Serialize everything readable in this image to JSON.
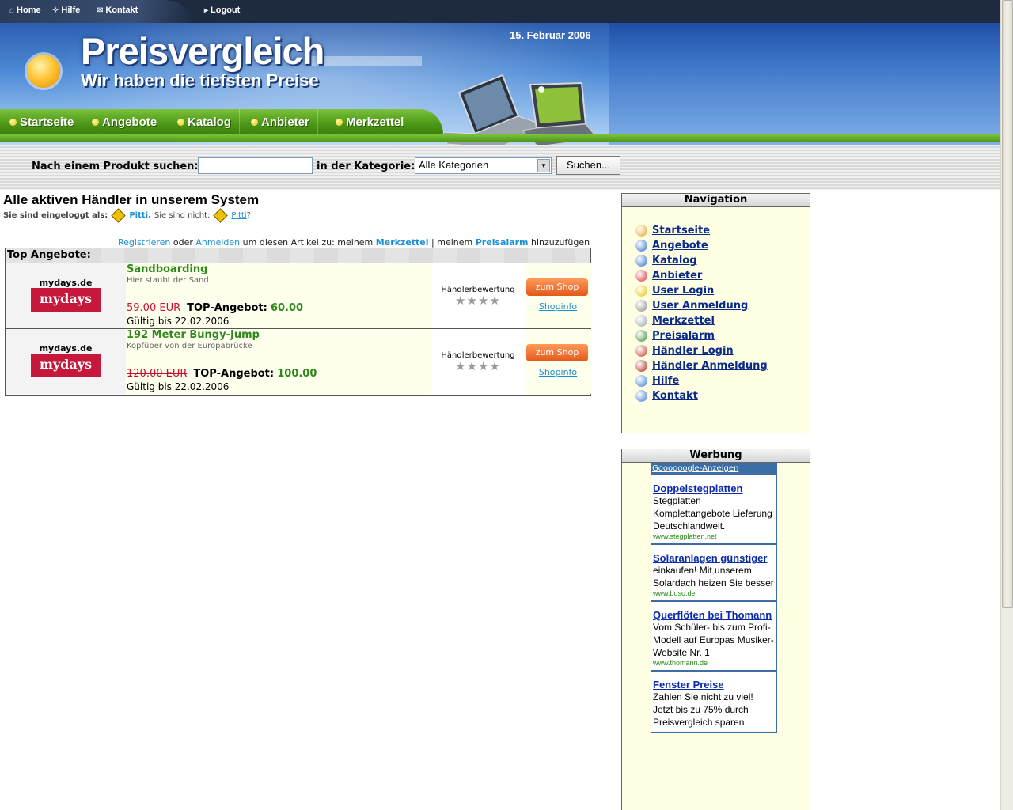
{
  "topbar": {
    "home": "Home",
    "help": "Hilfe",
    "contact": "Kontakt",
    "logout": "Logout"
  },
  "header": {
    "title": "Preisvergleich",
    "subtitle": "Wir haben die tiefsten Preise",
    "date": "15. Februar 2006"
  },
  "mainnav": [
    "Startseite",
    "Angebote",
    "Katalog",
    "Anbieter",
    "Merkzettel"
  ],
  "search": {
    "label": "Nach einem Produkt suchen:",
    "category_label": "in der Kategorie:",
    "category_value": "Alle Kategorien",
    "button": "Suchen...",
    "value": ""
  },
  "main": {
    "title": "Alle aktiven Händler in unserem System",
    "login_prefix": "Sie sind eingeloggt als:",
    "login_user": "Pitti.",
    "login_not": "Sie sind nicht:",
    "login_not_user": "Pitti",
    "login_q": "?",
    "reg_line": {
      "register": "Registrieren",
      "or": "oder",
      "login": "Anmelden",
      "text1": "um diesen Artikel zu: meinem",
      "merkzettel": "Merkzettel",
      "sep": "| meinem",
      "preisalarm": "Preisalarm",
      "text2": "hinzuzufügen"
    }
  },
  "offers": {
    "heading": "Top Angebote:",
    "top_label": "TOP-Angebot:",
    "rating_label": "Händlerbewertung",
    "shop_button": "zum Shop",
    "shopinfo": "Shopinfo",
    "items": [
      {
        "shop_small": "mydays.de",
        "shop_logo": "mydays",
        "title": "Sandboarding",
        "subtitle": "Hier staubt der Sand",
        "old_price": "59.00 EUR",
        "new_price": "60.00",
        "valid": "Gültig bis 22.02.2006",
        "stars": "★★★★"
      },
      {
        "shop_small": "mydays.de",
        "shop_logo": "mydays",
        "title": "192 Meter Bungy-Jump",
        "subtitle": "Kopfüber von der Europabrücke",
        "old_price": "120.00 EUR",
        "new_price": "100.00",
        "valid": "Gültig bis 22.02.2006",
        "stars": "★★★★"
      }
    ]
  },
  "sidebar": {
    "nav_title": "Navigation",
    "nav_items": [
      {
        "label": "Startseite",
        "icon": "home-icon",
        "color": "#f0a020"
      },
      {
        "label": "Angebote",
        "icon": "offers-icon",
        "color": "#2a6cd0"
      },
      {
        "label": "Katalog",
        "icon": "catalog-icon",
        "color": "#2a6cd0"
      },
      {
        "label": "Anbieter",
        "icon": "provider-icon",
        "color": "#d83030"
      },
      {
        "label": "User Login",
        "icon": "user-login-icon",
        "color": "#f0c000"
      },
      {
        "label": "User Anmeldung",
        "icon": "user-register-icon",
        "color": "#8a8a8a"
      },
      {
        "label": "Merkzettel",
        "icon": "notepad-icon",
        "color": "#9aa4b0"
      },
      {
        "label": "Preisalarm",
        "icon": "alarm-icon",
        "color": "#3a8a3a"
      },
      {
        "label": "Händler Login",
        "icon": "dealer-login-icon",
        "color": "#c83a2a"
      },
      {
        "label": "Händler Anmeldung",
        "icon": "dealer-register-icon",
        "color": "#b02020"
      },
      {
        "label": "Hilfe",
        "icon": "help-icon",
        "color": "#3a7ad8"
      },
      {
        "label": "Kontakt",
        "icon": "contact-icon",
        "color": "#3a7ad8"
      }
    ],
    "ads_title": "Werbung",
    "ads_header": "Goooooogle-Anzeigen",
    "ads": [
      {
        "title": "Doppelstegplatten",
        "desc": "Stegplatten Komplettangebote Lieferung Deutschlandweit.",
        "url": "www.stegplatten.net"
      },
      {
        "title": "Solaranlagen günstiger",
        "desc": "einkaufen! Mit unserem Solardach heizen Sie besser",
        "url": "www.buso.de"
      },
      {
        "title": "Querflöten bei Thomann",
        "desc": "Vom Schüler- bis zum Profi-Modell auf Europas Musiker-Website Nr. 1",
        "url": "www.thomann.de"
      },
      {
        "title": "Fenster Preise",
        "desc": "Zahlen Sie nicht zu viel! Jetzt bis zu 75% durch Preisvergleich sparen",
        "url": ""
      }
    ]
  }
}
